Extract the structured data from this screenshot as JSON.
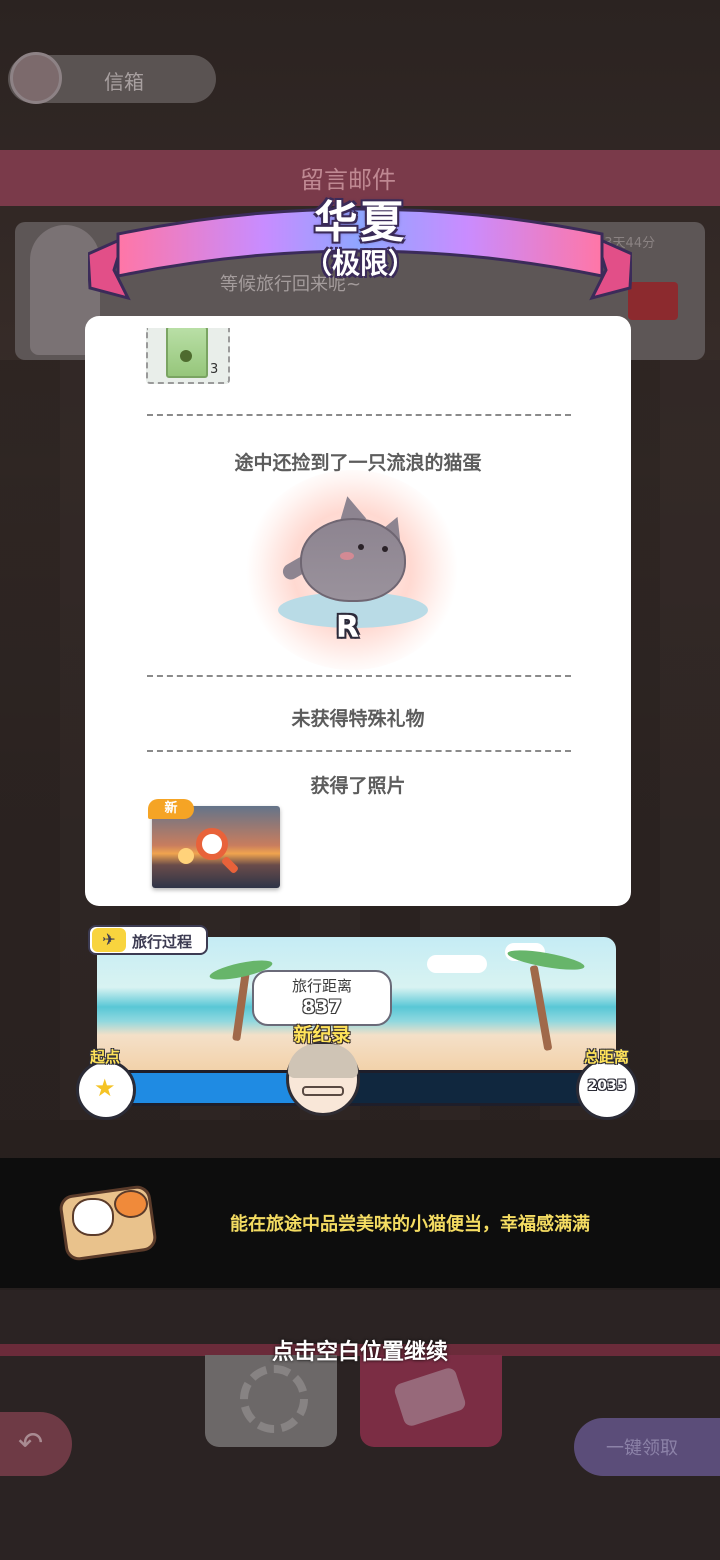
{
  "background": {
    "mailbox_label": "信箱",
    "section_title": "留言邮件",
    "card_message": "等候旅行回来呢~",
    "card_date": "13天44分"
  },
  "banner": {
    "destination": "华夏",
    "difficulty": "（极限）"
  },
  "rewards": {
    "item_count": "3",
    "cat_found_text": "途中还捡到了一只流浪的猫蛋",
    "cat_rank": "R",
    "special_gift_text": "未获得特殊礼物",
    "photo_text": "获得了照片",
    "photo_badge": "新"
  },
  "travel": {
    "tag_label": "旅行过程",
    "distance_label": "旅行距离",
    "distance_value": "837",
    "new_record": "新纪录",
    "start_label": "起点",
    "total_label": "总距离",
    "total_value": "2035",
    "progress_fraction": 0.411
  },
  "message": {
    "text": "能在旅途中品尝美味的小猫便当，幸福感满满"
  },
  "continue_hint": "点击空白位置继续",
  "bottom_bar": {
    "collect_all_label": "一键领取"
  },
  "colors": {
    "banner_gradient": [
      "#ff7aa8",
      "#b68cff",
      "#8ea0ff",
      "#ff7aa8"
    ],
    "progress_fill": "#1f8be3",
    "new_record": "#ffe35a",
    "message_text": "#f4dc62"
  },
  "icons": {
    "start_icon": "star-icon",
    "tag_icon": "airplane-icon",
    "photo_action": "magnifier-icon"
  }
}
